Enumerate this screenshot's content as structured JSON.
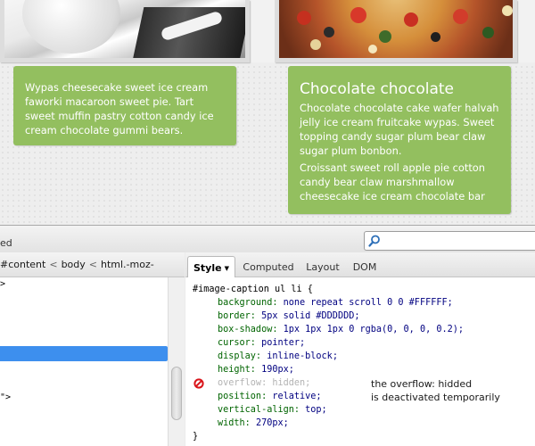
{
  "page": {
    "caption_left": {
      "text": "Wypas cheesecake sweet ice cream faworki macaroon sweet pie. Tart sweet muffin pastry cotton candy ice cream chocolate gummi bears."
    },
    "caption_right": {
      "title": "Chocolate chocolate",
      "paragraph1": "Chocolate chocolate cake wafer halvah jelly ice cream fruitcake wypas. Sweet topping candy sugar plum bear claw sugar plum bonbon.",
      "paragraph2": "Croissant sweet roll apple pie cotton candy bear claw marshmallow cheesecake ice cream chocolate bar"
    }
  },
  "devtools": {
    "toolbar_left_label": "ed",
    "search": {
      "icon": "magnifier-icon",
      "value": ""
    },
    "breadcrumb": {
      "items": [
        "#content",
        "body",
        "html.-moz-"
      ],
      "separator": "<"
    },
    "tree_rows": {
      "row1": ">",
      "row2": "",
      "row3": "",
      "row4": "",
      "row5": "\">",
      "row6": ""
    },
    "tabs": {
      "style": "Style",
      "computed": "Computed",
      "layout": "Layout",
      "dom": "DOM"
    },
    "rule": {
      "selector": "#image-caption ul li {",
      "closing": "}",
      "declarations": [
        {
          "prop": "background:",
          "value": "none repeat scroll 0 0 #FFFFFF;"
        },
        {
          "prop": "border:",
          "value": "5px solid #DDDDDD;"
        },
        {
          "prop": "box-shadow:",
          "value": "1px 1px 1px 0 rgba(0, 0, 0, 0.2);"
        },
        {
          "prop": "cursor:",
          "value": "pointer;"
        },
        {
          "prop": "display:",
          "value": "inline-block;"
        },
        {
          "prop": "height:",
          "value": "190px;"
        },
        {
          "prop": "overflow:",
          "value": "hidden;"
        },
        {
          "prop": "position:",
          "value": "relative;"
        },
        {
          "prop": "vertical-align:",
          "value": "top;"
        },
        {
          "prop": "width:",
          "value": "270px;"
        }
      ]
    },
    "annotation": {
      "line1": "the overflow: hidded",
      "line2": "is deactivated temporarily"
    }
  },
  "colors": {
    "caption_green": "#93bf5f",
    "selection_blue": "#3d8fee",
    "css_property": "#006400",
    "css_value": "#000080",
    "disabled_text": "#b3b3b3",
    "disable_icon": "#d9141a"
  }
}
